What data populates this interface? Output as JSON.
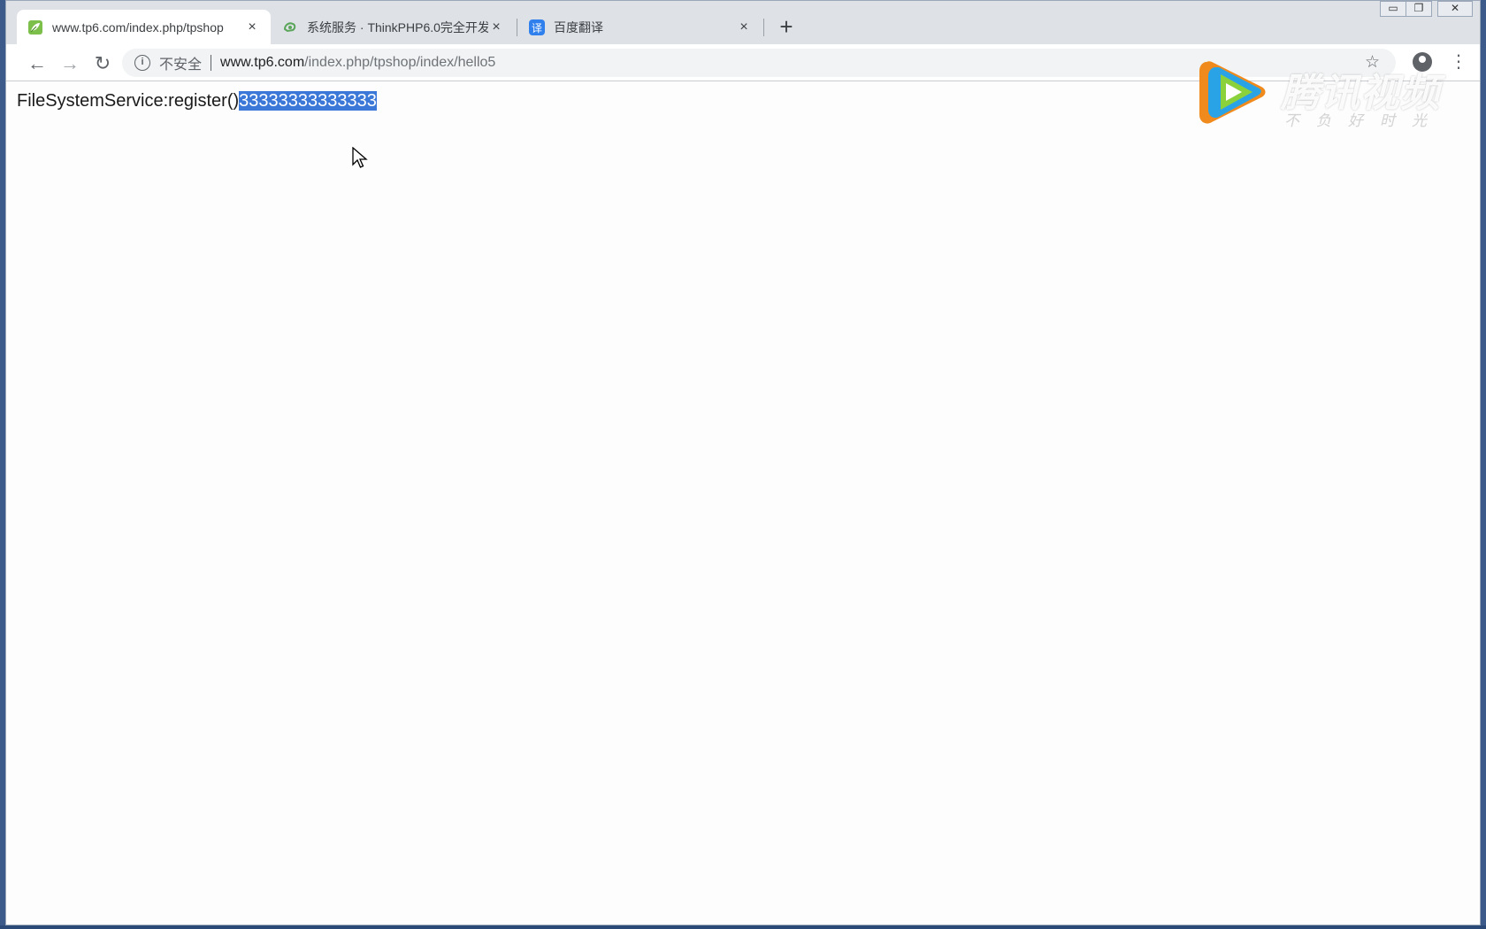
{
  "tabs": [
    {
      "title": "www.tp6.com/index.php/tpshop",
      "favicon": "tp-leaf-icon",
      "active": true,
      "close": "×"
    },
    {
      "title": "系统服务 · ThinkPHP6.0完全开发",
      "favicon": "kancloud-icon",
      "active": false,
      "close": "×"
    },
    {
      "title": "百度翻译",
      "favicon": "baidu-translate-icon",
      "active": false,
      "close": "×"
    }
  ],
  "new_tab_label": "+",
  "window_controls": {
    "minimize": "▭",
    "restore": "❐",
    "close": "✕"
  },
  "toolbar": {
    "back": "←",
    "forward": "→",
    "reload": "↻",
    "more": "⋮",
    "bookmark": "☆"
  },
  "omnibox": {
    "info": "i",
    "security_label": "不安全",
    "host": "www.tp6.com",
    "path": "/index.php/tpshop/index/hello5"
  },
  "page": {
    "text_prefix": "FileSystemService:register()",
    "text_selected": "33333333333333"
  },
  "watermark": {
    "brand": "腾讯视频",
    "slogan": "不负好时光"
  },
  "colors": {
    "selection": "#3b78d8",
    "tabstrip": "#dee1e6",
    "omnibox": "#f1f3f4"
  }
}
